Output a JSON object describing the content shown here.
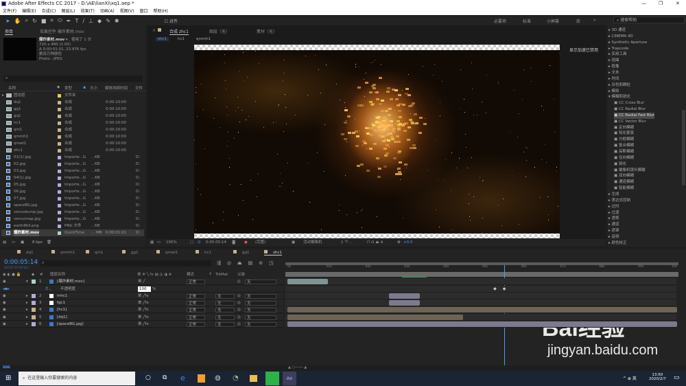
{
  "window": {
    "title": "Adobe After Effects CC 2017 - D:\\AE\\lianXi\\xq1.aep *"
  },
  "menu": [
    "文件(F)",
    "编辑(E)",
    "合成(C)",
    "图层(L)",
    "效果(T)",
    "动画(A)",
    "视图(V)",
    "窗口",
    "帮助(H)"
  ],
  "toolbar": {
    "snap_label": "对齐",
    "workspaces": [
      "必要项",
      "标准",
      "小屏幕",
      "库"
    ],
    "search_placeholder": "搜索帮助"
  },
  "project": {
    "tab": "项目",
    "effects_tab": "效果控件 爆炸素材.mov",
    "selected": {
      "name": "爆炸素材.mov",
      "used": "使用了 1 次",
      "dims": "720 x 480 (1.00)",
      "duration": "Δ 0:00:01:01, 23.976 fps",
      "colors": "数百万种颜色",
      "codec": "Photo - JPEG"
    },
    "columns": [
      "名称",
      "类型",
      "大小",
      "媒体持续时间",
      "文件"
    ],
    "items": [
      {
        "name": "固态层",
        "type": "文件夹",
        "size": "",
        "dur": "",
        "file": "",
        "color": "#e6d23c",
        "kind": "folder"
      },
      {
        "name": "dq1",
        "type": "合成",
        "size": "",
        "dur": "0:00:10:00",
        "file": "",
        "color": "#c8b38a",
        "kind": "comp"
      },
      {
        "name": "gg1",
        "type": "合成",
        "size": "",
        "dur": "0:00:10:00",
        "file": "",
        "color": "#c8b38a",
        "kind": "comp"
      },
      {
        "name": "gq1",
        "type": "合成",
        "size": "",
        "dur": "0:00:10:00",
        "file": "",
        "color": "#c8b38a",
        "kind": "comp"
      },
      {
        "name": "hc1",
        "type": "合成",
        "size": "",
        "dur": "0:00:10:00",
        "file": "",
        "color": "#c8b38a",
        "kind": "comp"
      },
      {
        "name": "qm1",
        "type": "合成",
        "size": "",
        "dur": "0:00:10:00",
        "file": "",
        "color": "#c8b38a",
        "kind": "comp"
      },
      {
        "name": "qmmh1",
        "type": "合成",
        "size": "",
        "dur": "0:00:10:00",
        "file": "",
        "color": "#c8b38a",
        "kind": "comp"
      },
      {
        "name": "qmwl1",
        "type": "合成",
        "size": "",
        "dur": "0:00:10:00",
        "file": "",
        "color": "#c8b38a",
        "kind": "comp"
      },
      {
        "name": "zhc1",
        "type": "合成",
        "size": "",
        "dur": "0:00:10:00",
        "file": "",
        "color": "#c8b38a",
        "kind": "comp"
      },
      {
        "name": "01(1).jpg",
        "type": "Importe...G",
        "size": "...KB",
        "dur": "",
        "file": "D:",
        "color": "#b4aadc",
        "kind": "file"
      },
      {
        "name": "02.jpg",
        "type": "Importe...G",
        "size": "...KB",
        "dur": "",
        "file": "D:",
        "color": "#b4aadc",
        "kind": "file"
      },
      {
        "name": "03.jpg",
        "type": "Importe...G",
        "size": "...KB",
        "dur": "",
        "file": "D:",
        "color": "#b4aadc",
        "kind": "file"
      },
      {
        "name": "04(1).jpg",
        "type": "Importe...G",
        "size": "...KB",
        "dur": "",
        "file": "D:",
        "color": "#b4aadc",
        "kind": "file"
      },
      {
        "name": "05.jpg",
        "type": "Importe...G",
        "size": "...KB",
        "dur": "",
        "file": "D:",
        "color": "#b4aadc",
        "kind": "file"
      },
      {
        "name": "06.jpg",
        "type": "Importe...G",
        "size": "...KB",
        "dur": "",
        "file": "D:",
        "color": "#b4aadc",
        "kind": "file"
      },
      {
        "name": "07.jpg",
        "type": "Importe...G",
        "size": "...KB",
        "dur": "",
        "file": "D:",
        "color": "#b4aadc",
        "kind": "file"
      },
      {
        "name": "spaceBG.jpg",
        "type": "Importe...G",
        "size": "...KB",
        "dur": "",
        "file": "D:",
        "color": "#b4aadc",
        "kind": "file"
      },
      {
        "name": "venusbump.jpg",
        "type": "Importe...G",
        "size": "...KB",
        "dur": "",
        "file": "D:",
        "color": "#b4aadc",
        "kind": "file"
      },
      {
        "name": "venusmap.jpg",
        "type": "Importe...G",
        "size": "...KB",
        "dur": "",
        "file": "D:",
        "color": "#b4aadc",
        "kind": "file"
      },
      {
        "name": "earth8kll.png",
        "type": "PNG 文件",
        "size": "...KB",
        "dur": "",
        "file": "D:",
        "color": "#b4aadc",
        "kind": "file"
      },
      {
        "name": "爆炸素材.mov",
        "type": "QuickTime",
        "size": "... MB",
        "dur": "0:00:01:01",
        "file": "D:",
        "color": "#a6d6cc",
        "kind": "file",
        "selected": true
      }
    ],
    "bpc": "8 bpc"
  },
  "viewer": {
    "tabs": [
      "合成 zhc1",
      "图层（无）",
      "素材（无）"
    ],
    "breadcrumbs": [
      "zhc1",
      "hc1",
      "qmmh1"
    ],
    "gpu_notice": "显示加速已禁用",
    "zoom": "100%",
    "timecode": "0:00:05:14",
    "resolution": "(完整)",
    "camera": "活动摄像机",
    "views": "1 个...",
    "exposure": "+0.0"
  },
  "effects": {
    "items": [
      {
        "label": "3D 通道",
        "level": 0
      },
      {
        "label": "CINEMA 4D",
        "level": 0
      },
      {
        "label": "Synthetic Aperture",
        "level": 0
      },
      {
        "label": "Trapcode",
        "level": 0
      },
      {
        "label": "实用工具",
        "level": 0
      },
      {
        "label": "扭曲",
        "level": 0
      },
      {
        "label": "抠像",
        "level": 0
      },
      {
        "label": "文本",
        "level": 0
      },
      {
        "label": "时间",
        "level": 0
      },
      {
        "label": "杂色和颗粒",
        "level": 0
      },
      {
        "label": "模拟",
        "level": 0
      },
      {
        "label": "模糊和锐化",
        "level": 0,
        "open": true
      },
      {
        "label": "CC Cross Blur",
        "level": 1
      },
      {
        "label": "CC Radial Blur",
        "level": 1
      },
      {
        "label": "CC Radial Fast Blur",
        "level": 1,
        "selected": true
      },
      {
        "label": "CC Vector Blur",
        "level": 1
      },
      {
        "label": "定向模糊",
        "level": 1
      },
      {
        "label": "钝化蒙版",
        "level": 1
      },
      {
        "label": "方框模糊",
        "level": 1
      },
      {
        "label": "复合模糊",
        "level": 1
      },
      {
        "label": "高斯模糊",
        "level": 1
      },
      {
        "label": "径向模糊",
        "level": 1
      },
      {
        "label": "锐化",
        "level": 1
      },
      {
        "label": "摄像机镜头模糊",
        "level": 1
      },
      {
        "label": "双向模糊",
        "level": 1
      },
      {
        "label": "通道模糊",
        "level": 1
      },
      {
        "label": "智能模糊",
        "level": 1
      },
      {
        "label": "生成",
        "level": 0
      },
      {
        "label": "表达式控制",
        "level": 0
      },
      {
        "label": "过时",
        "level": 0
      },
      {
        "label": "过渡",
        "level": 0
      },
      {
        "label": "透视",
        "level": 0
      },
      {
        "label": "通道",
        "level": 0
      },
      {
        "label": "遮罩",
        "level": 0
      },
      {
        "label": "音频",
        "level": 0
      },
      {
        "label": "颜色校正",
        "level": 0
      }
    ]
  },
  "timeline": {
    "tabs": [
      "dq1",
      "qmmh1",
      "qm1",
      "gg1",
      "qmwl1",
      "hc1",
      "gq1",
      "zhc1"
    ],
    "active_tab": "zhc1",
    "timecode": "0:00:05:14",
    "frames": "00139 (25.00 fps)",
    "columns": {
      "name": "图层名称",
      "mode": "模式",
      "t": "T",
      "trkmat": "TrkMat",
      "parent": "父级"
    },
    "ruler": [
      "0s",
      "01s",
      "02s",
      "03s",
      "04s",
      "05s",
      "06s",
      "07s",
      "08s",
      "09s",
      "10s"
    ],
    "current_time_s": 5.56,
    "layers": [
      {
        "num": "1",
        "name": "[爆炸素材.mov]",
        "color": "#a6d6cc",
        "mode": "正常",
        "trkmat": "",
        "parent": "无",
        "bar": [
          0,
          1.04
        ],
        "bar_color": "#7f9494"
      },
      {
        "num": "2",
        "name": "mhc1",
        "color": "#b4aadc",
        "mode": "正常",
        "trkmat": "无",
        "parent": "无",
        "bar": [
          2.6,
          3.4
        ],
        "bar_color": "#7c7a8e"
      },
      {
        "num": "3",
        "name": "fgc1",
        "color": "#b4aadc",
        "mode": "正常",
        "trkmat": "无",
        "parent": "无",
        "bar": [
          2.6,
          3.4
        ],
        "bar_color": "#7c7a8e"
      },
      {
        "num": "4",
        "name": "[hc1]",
        "color": "#c8b38a",
        "mode": "正常",
        "trkmat": "无",
        "parent": "无",
        "bar": [
          0,
          10
        ],
        "bar_color": "#6d6455"
      },
      {
        "num": "5",
        "name": "[dq1]",
        "color": "#c8b38a",
        "mode": "正常",
        "trkmat": "无",
        "parent": "无",
        "bar": [
          0,
          4.5
        ],
        "bar_color": "#6d6455"
      },
      {
        "num": "6",
        "name": "[spaceBG.jpg]",
        "color": "#b4aadc",
        "mode": "正常",
        "trkmat": "无",
        "parent": "无",
        "bar": [
          0,
          10
        ],
        "bar_color": "#7c7a8e"
      }
    ],
    "opacity_prop": {
      "label": "不透明度",
      "value": "100",
      "unit": "%"
    }
  },
  "taskbar": {
    "search_placeholder": "在这里输入你要搜索的内容",
    "ime": "英",
    "time": "13:50",
    "date": "2020/2/7"
  },
  "watermark": {
    "text": "Bai经验",
    "url": "jingyan.baidu.com"
  }
}
